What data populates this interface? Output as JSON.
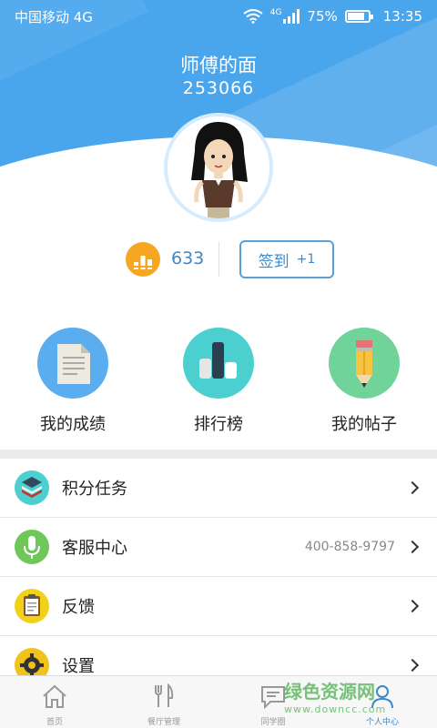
{
  "status_bar": {
    "carrier": "中国移动 4G",
    "network": "4G",
    "battery": "75%",
    "time": "13:35"
  },
  "profile": {
    "name": "师傅的面",
    "id": "253066",
    "coins": "633",
    "checkin_label": "签到",
    "checkin_bonus": "+1"
  },
  "quick_actions": [
    {
      "label": "我的成绩",
      "icon": "document-icon",
      "color": "#5aaef0"
    },
    {
      "label": "排行榜",
      "icon": "bar-rank-icon",
      "color": "#4ccfcf"
    },
    {
      "label": "我的帖子",
      "icon": "pencil-icon",
      "color": "#6fd39a"
    }
  ],
  "menu": [
    {
      "label": "积分任务",
      "value": "",
      "icon": "stack-icon",
      "color": "#4ccfcf"
    },
    {
      "label": "客服中心",
      "value": "400-858-9797",
      "icon": "microphone-icon",
      "color": "#6fc75a"
    },
    {
      "label": "反馈",
      "value": "",
      "icon": "clipboard-icon",
      "color": "#f0d21a"
    },
    {
      "label": "设置",
      "value": "",
      "icon": "gear-icon",
      "color": "#f0c21a"
    }
  ],
  "nav": [
    {
      "label": "首页",
      "icon": "home-icon"
    },
    {
      "label": "餐厅管理",
      "icon": "fork-knife-icon"
    },
    {
      "label": "同学圈",
      "icon": "chat-icon"
    },
    {
      "label": "个人中心",
      "icon": "person-icon"
    }
  ],
  "watermark": {
    "title": "绿色资源网",
    "url": "www.downcc.com"
  }
}
